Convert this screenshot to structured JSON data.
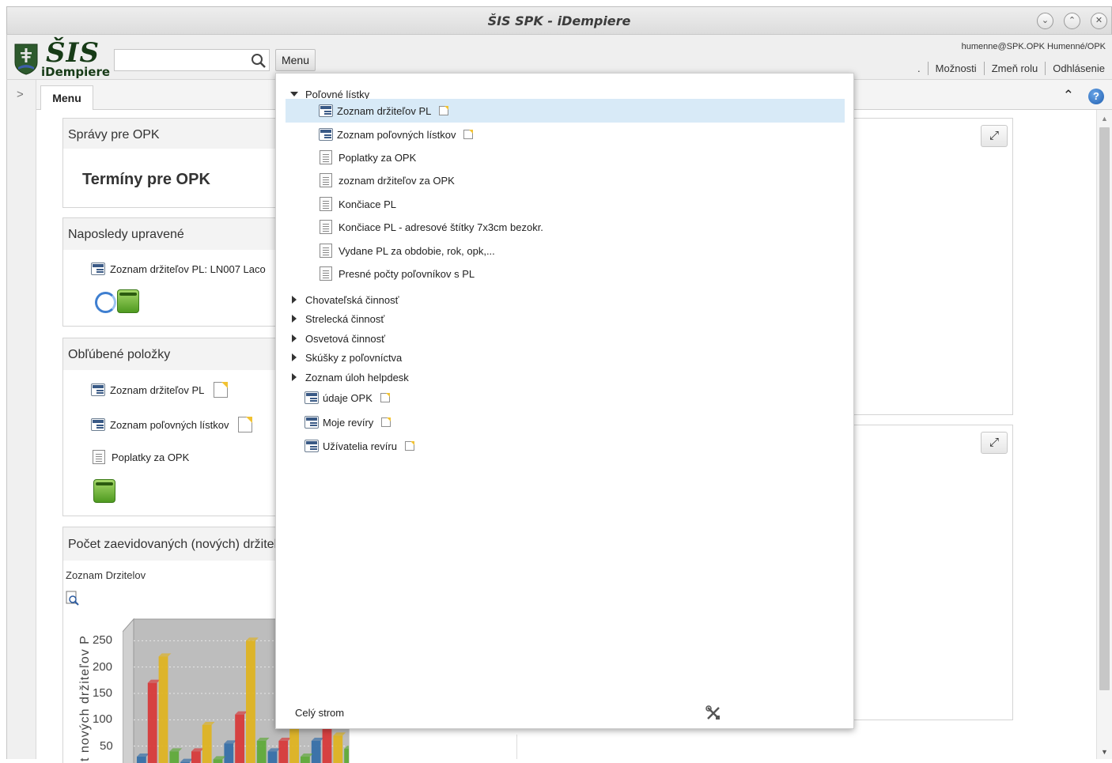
{
  "window": {
    "title": "ŠIS SPK - iDempiere"
  },
  "header": {
    "logo_main": "ŠIS",
    "logo_sub": "iDempiere",
    "search_placeholder": "",
    "menu_button": "Menu",
    "user_info": "humenne@SPK.OPK Humenné/OPK",
    "links": {
      "dot": ".",
      "options": "Možnosti",
      "change_role": "Zmeň rolu",
      "logout": "Odhlásenie"
    }
  },
  "tabs": {
    "menu": "Menu"
  },
  "panels": {
    "notices": {
      "title": "Správy pre OPK",
      "content": "Termíny pre OPK"
    },
    "recent": {
      "title": "Naposledy upravené",
      "item": "Zoznam držiteľov PL: LN007 Laco"
    },
    "favorites": {
      "title": "Obľúbené položky",
      "items": [
        "Zoznam držiteľov PL",
        "Zoznam poľovných lístkov",
        "Poplatky za OPK"
      ]
    },
    "chart": {
      "title": "Počet zaevidovaných (nových) držitel",
      "subtitle": "Zoznam Drzitelov",
      "ylabel_visible": "t nových držiteľov P"
    }
  },
  "chart_data": {
    "type": "bar",
    "title": "Zoznam Drzitelov",
    "ylabel": "t nových držiteľov P",
    "y_ticks": [
      250,
      200,
      150,
      100,
      50
    ],
    "ylim": [
      0,
      300
    ],
    "grid": true,
    "series": [
      {
        "values": [
          30,
          20,
          55,
          40,
          60
        ]
      },
      {
        "values": [
          170,
          40,
          110,
          60,
          90
        ]
      },
      {
        "values": [
          220,
          90,
          250,
          130,
          70
        ]
      },
      {
        "values": [
          40,
          25,
          60,
          30,
          45
        ]
      }
    ],
    "categories": [
      "",
      "",
      "",
      "",
      ""
    ],
    "colors": [
      "#2f6aa6",
      "#d83333",
      "#e0b21a",
      "#5aa832"
    ]
  },
  "menu_tree": {
    "root": "Poľovné lístky",
    "children": [
      {
        "label": "Zoznam držiteľov PL",
        "type": "window",
        "note": true
      },
      {
        "label": "Zoznam poľovných lístkov",
        "type": "window",
        "note": true
      },
      {
        "label": "Poplatky za OPK",
        "type": "report",
        "note": false
      },
      {
        "label": "zoznam držiteľov za OPK",
        "type": "report",
        "note": false
      },
      {
        "label": "Končiace PL",
        "type": "report",
        "note": false
      },
      {
        "label": "Končiace PL - adresové štítky 7x3cm bezokr.",
        "type": "report",
        "note": false
      },
      {
        "label": "Vydane PL za obdobie, rok, opk,...",
        "type": "report",
        "note": false
      },
      {
        "label": "Presné počty poľovníkov s PL",
        "type": "report",
        "note": false
      }
    ],
    "collapsed": [
      "Chovateľská činnosť",
      "Strelecká činnosť",
      "Osvetová činnosť",
      "Skúšky z poľovníctva",
      "Zoznam úloh helpdesk"
    ],
    "leaves": [
      "údaje OPK",
      "Moje revíry",
      "Užívatelia revíru"
    ],
    "footer": "Celý strom"
  },
  "icons": {
    "search": "search-icon",
    "expand": "expand-icon",
    "help": "help-icon",
    "tools": "tools-icon"
  }
}
